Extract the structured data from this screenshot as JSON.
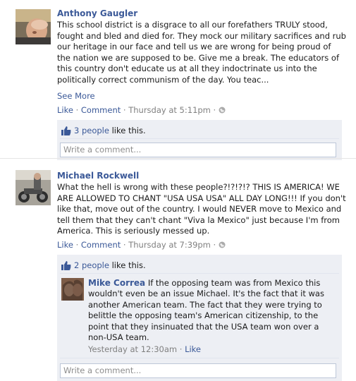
{
  "posts": [
    {
      "author": "Anthony Gaugler",
      "text": "This school district is a disgrace to all our forefathers TRULY stood, fought and bled and died for. They mock our military sacrifices and rub our heritage in our face and tell us we are wrong for being proud of the nation we are supposed to be. Give me a break. The educators of this country don't educate us at all they indoctrinate us into the politically correct communism of the day. You teac...",
      "see_more": "See More",
      "like": "Like",
      "comment": "Comment",
      "timestamp": "Thursday at 5:11pm",
      "likes_count": "3 people",
      "likes_suffix": " like this.",
      "comment_placeholder": "Write a comment..."
    },
    {
      "author": "Michael Rockwell",
      "text": "What the hell is wrong with these people?!?!?!? THIS IS AMERICA! WE ARE ALLOWED TO CHANT \"USA USA USA\" ALL DAY LONG!!! If you don't like that, move out of the country. I would NEVER move to Mexico and tell them that they can't chant \"Viva la Mexico\" just because I'm from America. This is seriously messed up.",
      "like": "Like",
      "comment": "Comment",
      "timestamp": "Thursday at 7:39pm",
      "likes_count": "2 people",
      "likes_suffix": " like this.",
      "reply": {
        "author": "Mike Correa",
        "text": "If the opposing team was from Mexico this wouldn't even be an issue Michael. It's the fact that it was another American team. The fact that they were trying to belittle the opposing team's American citizenship, to the point that they insinuated that the USA team won over a non-USA team.",
        "timestamp": "Yesterday at 12:30am",
        "like": "Like"
      },
      "comment_placeholder": "Write a comment..."
    }
  ],
  "separators": {
    "dot": " · "
  },
  "colors": {
    "link": "#3b5998",
    "meta": "#808080",
    "likes_bg": "#edeff4"
  },
  "icons": {
    "thumb": "thumbs-up-icon",
    "globe": "globe-icon"
  }
}
